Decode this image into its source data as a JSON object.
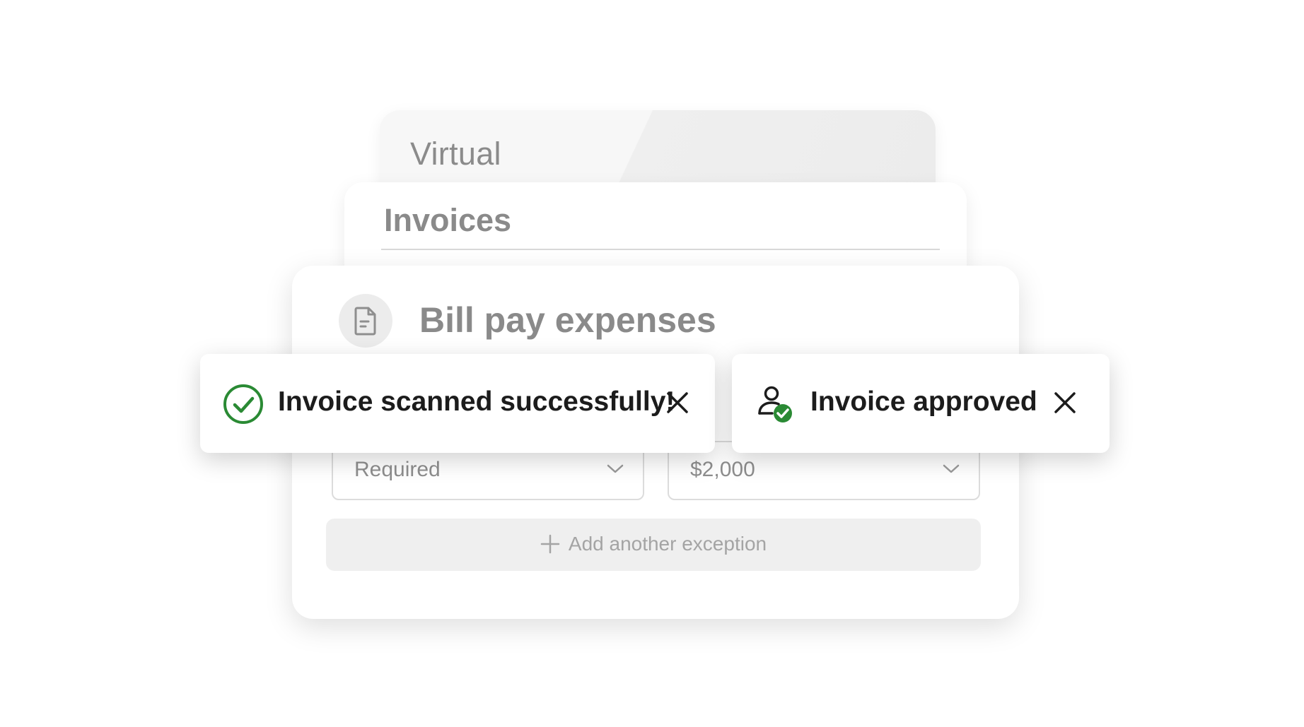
{
  "cards": {
    "virtual": {
      "title": "Virtual"
    },
    "invoices": {
      "title": "Invoices"
    },
    "bill_pay": {
      "title": "Bill pay expenses",
      "icon": "document-icon",
      "selects": [
        {
          "value": "Required"
        },
        {
          "value": "$2,000"
        }
      ],
      "add_button_label": "Add another exception"
    }
  },
  "toasts": [
    {
      "message": "Invoice scanned successfully!",
      "icon": "check-circle-icon",
      "color": "#2a8a34"
    },
    {
      "message": "Invoice approved",
      "icon": "user-check-icon",
      "color": "#2a8a34"
    }
  ]
}
